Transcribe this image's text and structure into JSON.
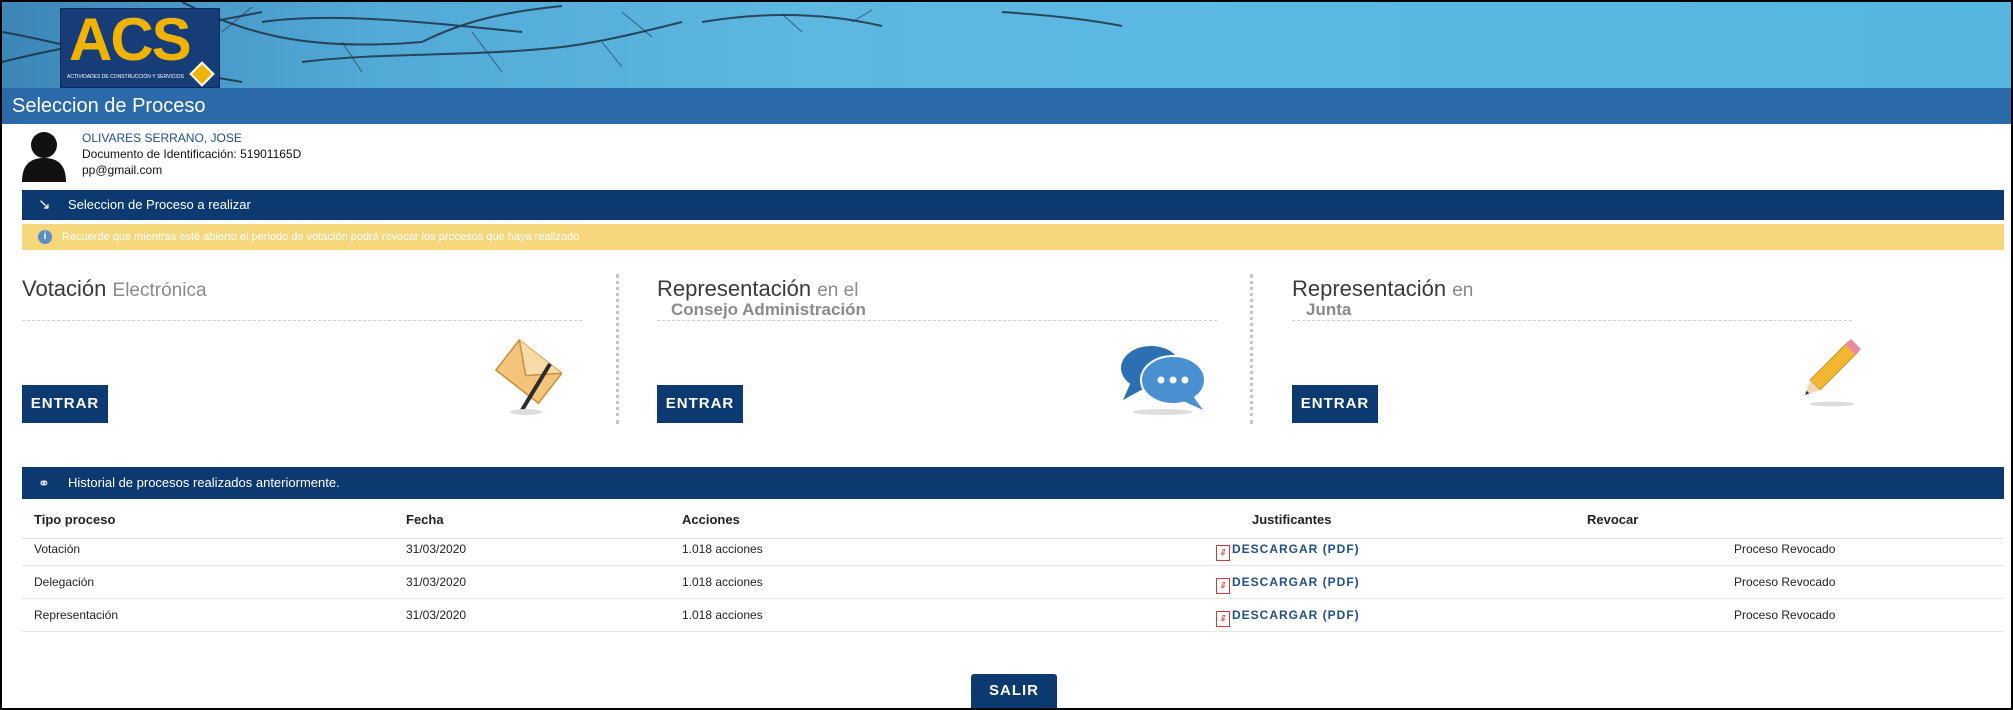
{
  "header": {
    "logo_text": "ACS",
    "logo_subtitle": "ACTIVIDADES DE CONSTRUCCIÓN Y SERVICIOS",
    "page_title": "Seleccion de Proceso"
  },
  "user": {
    "name": "OLIVARES SERRANO, JOSE",
    "document": "Documento de Identificación: 51901165D",
    "email": "pp@gmail.com"
  },
  "process_section": {
    "title": "Seleccion de Proceso a realizar",
    "notice": "Recuerde que mientras esté abierto el periodo de votación podrá revocar los procesos que haya realizado"
  },
  "options": [
    {
      "title": "Votación",
      "title_muted": "Electrónica",
      "subtitle": "",
      "button": "ENTRAR",
      "icon": "envelope-icon"
    },
    {
      "title": "Representación",
      "title_muted": "en el",
      "subtitle": "Consejo Administración",
      "button": "ENTRAR",
      "icon": "chat-bubbles-icon"
    },
    {
      "title": "Representación",
      "title_muted": "en",
      "subtitle": "Junta",
      "button": "ENTRAR",
      "icon": "pencil-icon"
    }
  ],
  "history": {
    "title": "Historial de procesos realizados anteriormente.",
    "columns": [
      "Tipo proceso",
      "Fecha",
      "Acciones",
      "Justificantes",
      "Revocar"
    ],
    "rows": [
      {
        "tipo": "Votación",
        "fecha": "31/03/2020",
        "acciones": "1.018 acciones",
        "justificante": "DESCARGAR (PDF)",
        "revocar": "Proceso Revocado"
      },
      {
        "tipo": "Delegación",
        "fecha": "31/03/2020",
        "acciones": "1.018 acciones",
        "justificante": "DESCARGAR (PDF)",
        "revocar": "Proceso Revocado"
      },
      {
        "tipo": "Representación",
        "fecha": "31/03/2020",
        "acciones": "1.018 acciones",
        "justificante": "DESCARGAR (PDF)",
        "revocar": "Proceso Revocado"
      }
    ]
  },
  "footer": {
    "exit_button": "SALIR"
  },
  "colors": {
    "primary_navy": "#0c3a70",
    "title_blue": "#2a6aa8",
    "notice_yellow": "#f6d77c",
    "logo_gold": "#f0b400"
  }
}
